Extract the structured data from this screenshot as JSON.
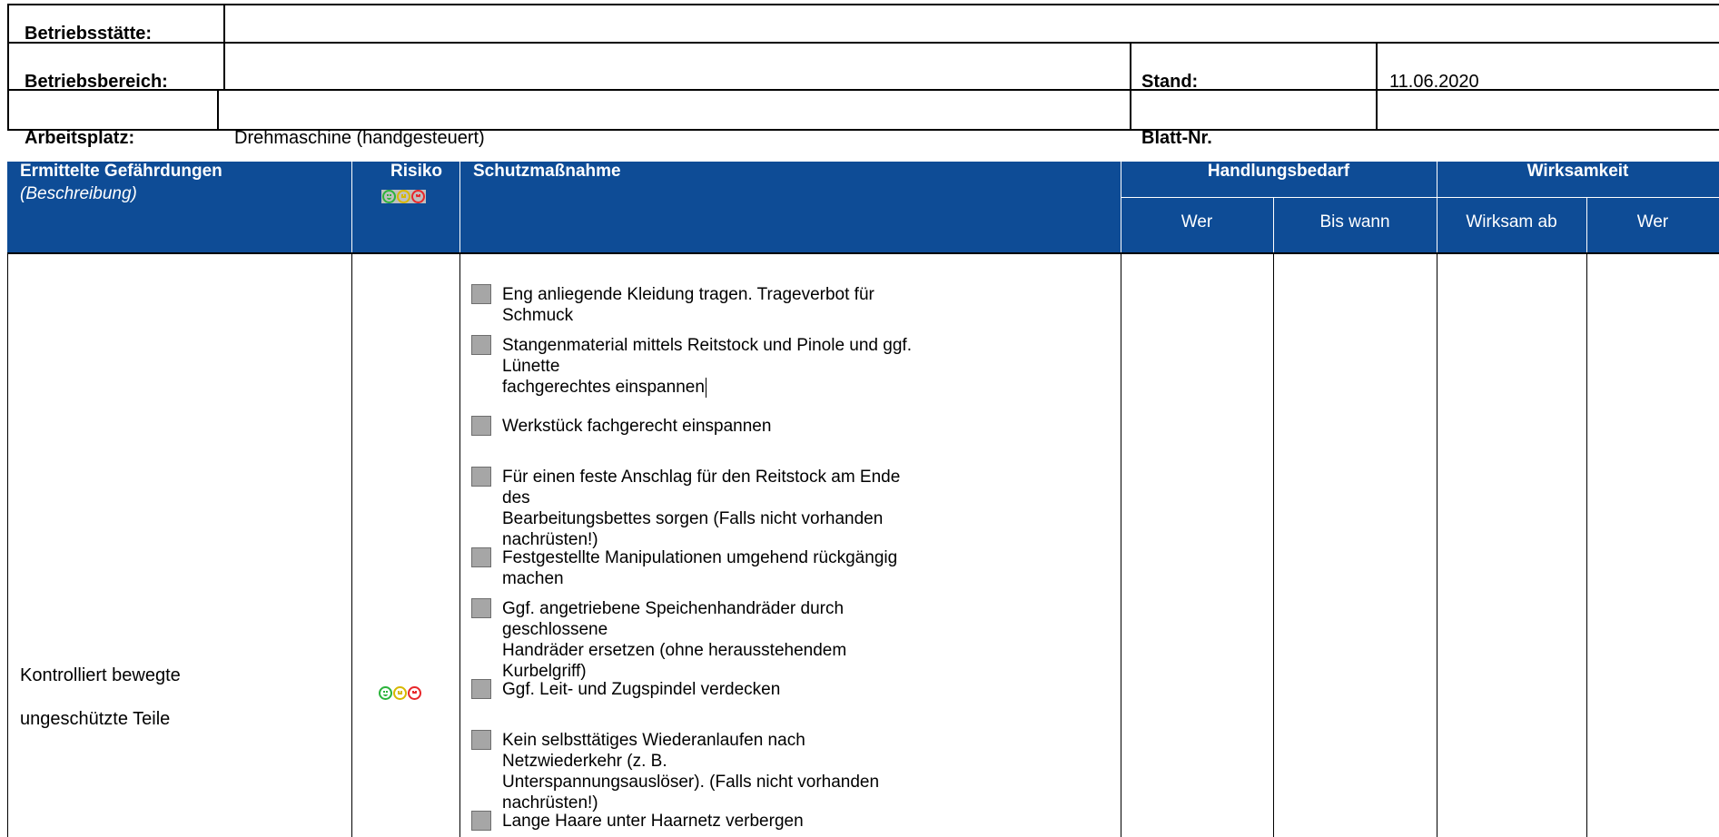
{
  "header": {
    "betriebsstaette_label": "Betriebsstätte:",
    "betriebsstaette_value": "",
    "betriebsbereich_label": "Betriebsbereich:",
    "betriebsbereich_value": "",
    "stand_label": "Stand:",
    "stand_value": "11.06.2020",
    "arbeitsplatz_label": "Arbeitsplatz:",
    "arbeitsplatz_value": "Drehmaschine (handgesteuert)",
    "blatt_label": "Blatt-Nr.",
    "blatt_value": ""
  },
  "table_header": {
    "gefaehrdungen": "Ermittelte Gefährdungen",
    "beschreibung": "(Beschreibung)",
    "risiko": "Risiko",
    "schutzmassnahme": "Schutzmaßnahme",
    "handlungsbedarf": "Handlungsbedarf",
    "wirksamkeit": "Wirksamkeit",
    "wer": "Wer",
    "bis_wann": "Bis wann",
    "wirksam_ab": "Wirksam ab",
    "wer2": "Wer"
  },
  "row": {
    "gefaehrdung_line1": "Kontrolliert bewegte",
    "gefaehrdung_line2": "ungeschützte Teile",
    "risiko_icons": [
      "smiley-green-icon",
      "smiley-neutral-yellow-icon",
      "smiley-sad-red-icon"
    ],
    "massnahmen": [
      {
        "line1": "Eng anliegende Kleidung tragen. Trageverbot für Schmuck",
        "line2": "",
        "checked": false
      },
      {
        "line1": "Stangenmaterial mittels Reitstock und Pinole und ggf. Lünette",
        "line2": "fachgerechtes einspannen",
        "checked": false
      },
      {
        "line1": "Werkstück fachgerecht einspannen",
        "line2": "",
        "checked": false
      },
      {
        "line1": "Für einen feste Anschlag für den Reitstock am Ende des",
        "line2": "Bearbeitungsbettes sorgen (Falls nicht vorhanden nachrüsten!)",
        "checked": false
      },
      {
        "line1": "Festgestellte Manipulationen umgehend rückgängig machen",
        "line2": "",
        "checked": false
      },
      {
        "line1": "Ggf. angetriebene Speichenhandräder durch geschlossene",
        "line2": "Handräder ersetzen (ohne herausstehendem Kurbelgriff)",
        "checked": false
      },
      {
        "line1": "Ggf. Leit- und Zugspindel verdecken",
        "line2": "",
        "checked": false
      },
      {
        "line1": "Kein selbsttätiges Wiederanlaufen nach Netzwiederkehr (z. B.",
        "line2": "Unterspannungsauslöser). (Falls nicht vorhanden nachrüsten!)",
        "checked": false
      },
      {
        "line1": "Lange Haare unter Haarnetz verbergen",
        "line2": "",
        "checked": false
      }
    ]
  },
  "colors": {
    "header_blue": "#0e4c96",
    "checkbox_gray": "#a6a6a6"
  }
}
